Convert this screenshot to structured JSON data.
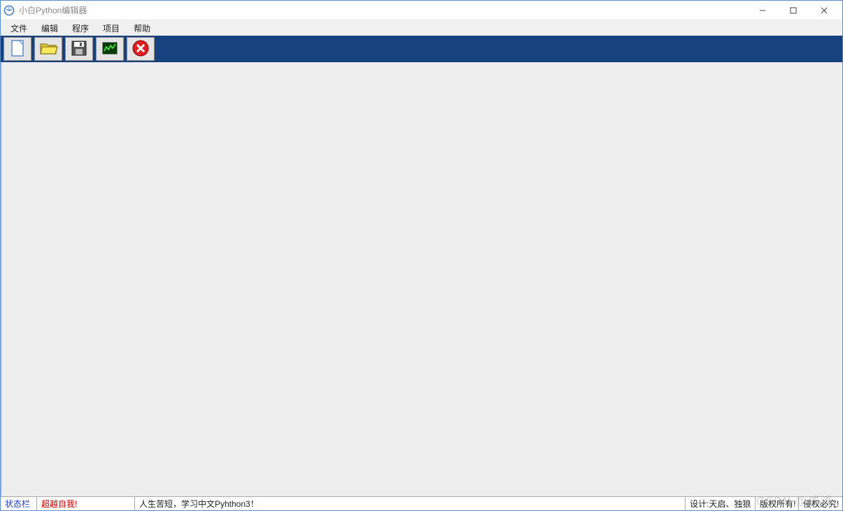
{
  "window": {
    "title": "小白Python编辑器"
  },
  "menu": {
    "items": [
      "文件",
      "编辑",
      "程序",
      "项目",
      "帮助"
    ]
  },
  "toolbar": {
    "icons": [
      "new-file-icon",
      "open-folder-icon",
      "save-icon",
      "run-icon",
      "stop-icon"
    ]
  },
  "status": {
    "label": "状态栏",
    "motto": "超越自我!",
    "message": "人生苦短，学习中文Pyhthon3！",
    "designer": "设计:天启、独狼",
    "copyright": "版权所有!",
    "legal": "侵权必究!"
  },
  "watermark": "CSDN @成浦"
}
